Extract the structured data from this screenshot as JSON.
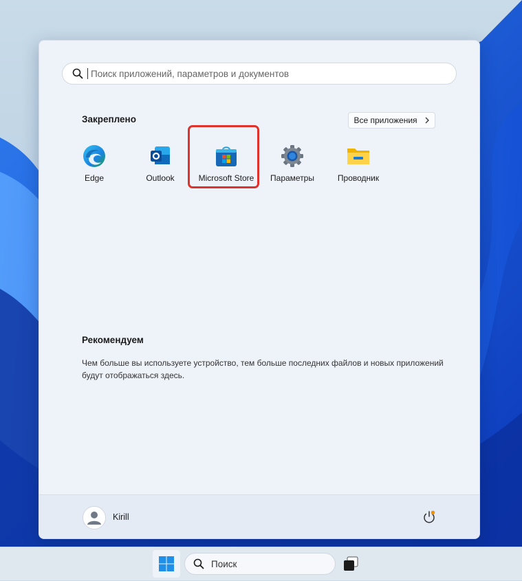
{
  "search": {
    "placeholder": "Поиск приложений, параметров и документов"
  },
  "pinned": {
    "title": "Закреплено",
    "all_apps_label": "Все приложения",
    "apps": [
      {
        "label": "Edge",
        "icon": "edge-icon"
      },
      {
        "label": "Outlook",
        "icon": "outlook-icon"
      },
      {
        "label": "Microsoft Store",
        "icon": "microsoft-store-icon",
        "highlighted": true
      },
      {
        "label": "Параметры",
        "icon": "settings-gear-icon"
      },
      {
        "label": "Проводник",
        "icon": "file-explorer-folder-icon"
      }
    ]
  },
  "recommended": {
    "title": "Рекомендуем",
    "text": "Чем больше вы используете устройство, тем больше последних файлов и новых приложений будут отображаться здесь."
  },
  "footer": {
    "username": "Kirill"
  },
  "taskbar": {
    "search_label": "Поиск"
  },
  "colors": {
    "highlight": "#e0322c",
    "accent": "#0067c0"
  }
}
